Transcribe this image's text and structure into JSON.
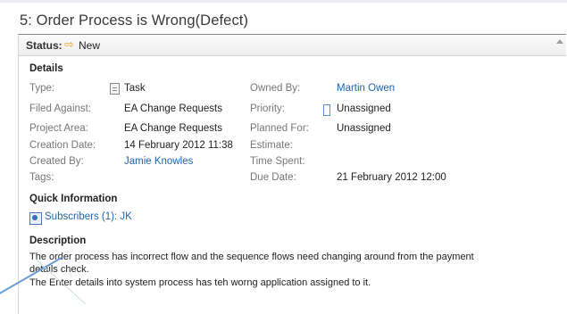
{
  "title": "5: Order Process is Wrong(Defect)",
  "status": {
    "label": "Status:",
    "value": "New",
    "icon": "arrow-right-icon"
  },
  "details": {
    "heading": "Details",
    "type_label": "Type:",
    "type_value": "Task",
    "filed_label": "Filed Against:",
    "filed_value": "EA Change Requests",
    "area_label": "Project Area:",
    "area_value": "EA Change Requests",
    "created_label": "Creation Date:",
    "created_value": "14 February 2012 11:38",
    "createdby_label": "Created By:",
    "createdby_value": "Jamie Knowles",
    "tags_label": "Tags:",
    "owned_label": "Owned By:",
    "owned_value": "Martin Owen",
    "priority_label": "Priority:",
    "priority_value": "Unassigned",
    "planned_label": "Planned For:",
    "planned_value": "Unassigned",
    "estimate_label": "Estimate:",
    "timespent_label": "Time Spent:",
    "due_label": "Due Date:",
    "due_value": "21 February 2012 12:00"
  },
  "quick": {
    "heading": "Quick Information",
    "subscribers": "Subscribers (1): JK"
  },
  "description": {
    "heading": "Description",
    "line1": "The order process has incorrect flow and the sequence flows need changing around from the payment",
    "line2": "details check.",
    "line3": "The Enter details into system process has teh worng application assigned to it."
  },
  "colors": {
    "link": "#1f64b0",
    "status_arrow": "#e8a21a",
    "label": "#777777"
  }
}
